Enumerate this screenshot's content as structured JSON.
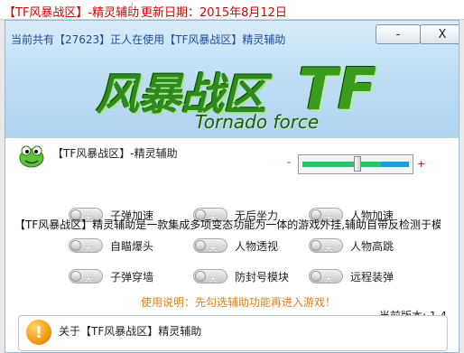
{
  "host": {
    "title": "【TF风暴战区】-精灵辅助",
    "date": "更新日期：2015年8月12日"
  },
  "window": {
    "head_info": "当前共有【27623】正人在使用【TF风暴战区】精灵辅助",
    "minimize_label": "-",
    "close_label": "X",
    "logo_main": "风暴战区",
    "logo_tf": "TF",
    "logo_sub": "Tornado force"
  },
  "panel": {
    "title": "【TF风暴战区】-精灵辅助",
    "slider": {
      "minus": "-",
      "plus": "+",
      "level": 0.52
    },
    "toggle_text": "关",
    "options": [
      {
        "label": "子弹加速"
      },
      {
        "label": "无后坐力"
      },
      {
        "label": "人物加速"
      },
      {
        "label": "自瞄爆头"
      },
      {
        "label": "人物透视"
      },
      {
        "label": "人物高跳"
      },
      {
        "label": "子弹穿墙"
      },
      {
        "label": "防封号模块"
      },
      {
        "label": "远程装弹"
      }
    ],
    "usage": "使用说明：先勾选辅助功能再进入游戏！",
    "version": "当前版本: 1.4",
    "about_title": "关于【TF风暴战区】精灵辅助",
    "about_text": "【TF风暴战区】精灵辅助是一款集成多项变态功能为一体的游戏外挂,辅助自带反检测于模块和智能抓包过滤功能,了会出现任何错误提示和封号现象,本辅助永久免费闪"
  },
  "colors": {
    "host_text": "#d40000",
    "head_text": "#1d4e9f",
    "usage_text": "#e2801c",
    "slider_green": "#22c96a",
    "slider_blue": "#1b9be0"
  },
  "icons": {
    "frog": "frog-mascot-icon",
    "about": "exclamation-icon"
  }
}
